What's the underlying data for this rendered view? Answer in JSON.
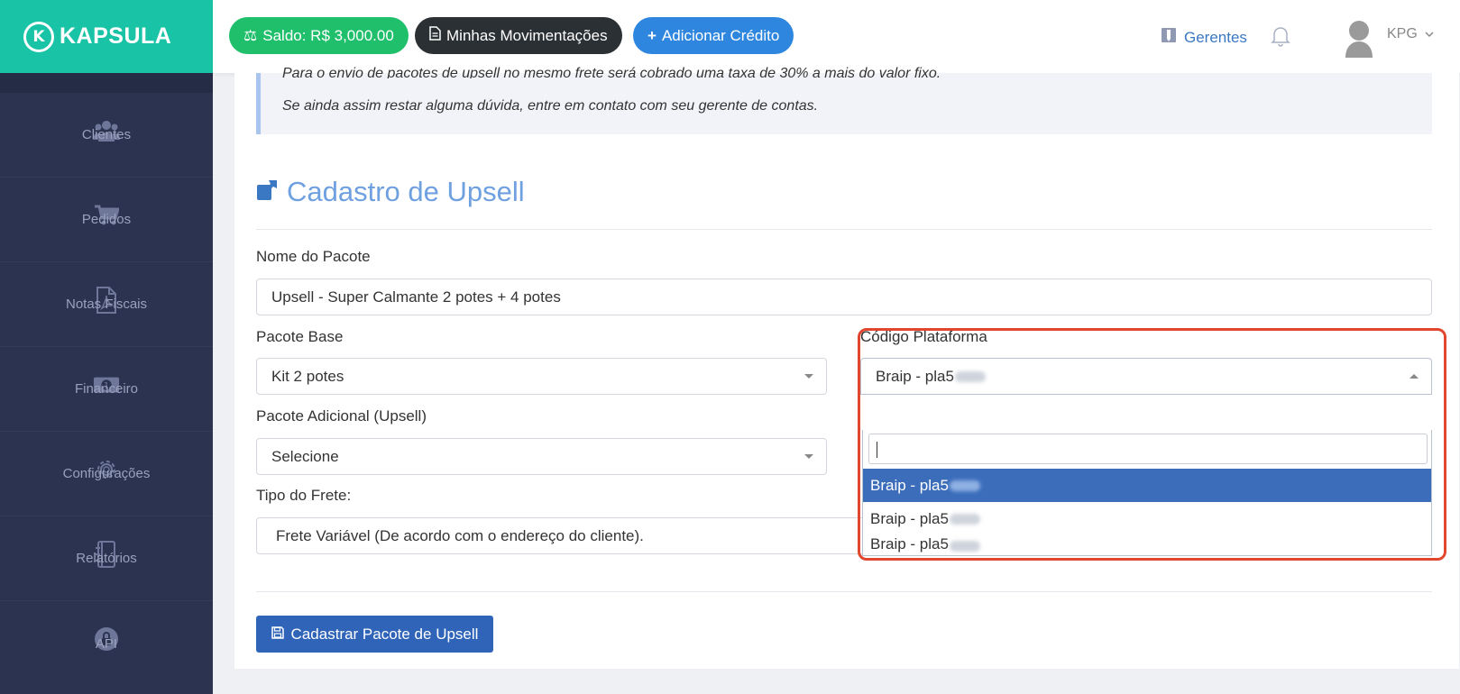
{
  "brand": {
    "name": "KAPSULA"
  },
  "sidebar": {
    "items": [
      {
        "label": "Clientes",
        "icon": "users-icon"
      },
      {
        "label": "Pedidos",
        "icon": "cart-icon"
      },
      {
        "label": "Notas Fiscais",
        "icon": "pdf-file-icon"
      },
      {
        "label": "Financeiro",
        "icon": "money-icon"
      },
      {
        "label": "Configurações",
        "icon": "gear-icon"
      },
      {
        "label": "Relatórios",
        "icon": "notebook-icon"
      },
      {
        "label": "API",
        "icon": "lock-icon"
      }
    ]
  },
  "topbar": {
    "saldo": "Saldo: R$ 3,000.00",
    "movimentacoes": "Minhas Movimentações",
    "adicionar": "Adicionar Crédito",
    "gerentes": "Gerentes",
    "user": "KPG"
  },
  "notice": {
    "cut_line": "Para o envio de pacotes de upsell no mesmo frete será cobrado uma taxa de 30% a mais do valor fixo.",
    "text": "Se ainda assim restar alguma dúvida, entre em contato com seu gerente de contas."
  },
  "form": {
    "title": "Cadastro de Upsell",
    "nome_label": "Nome do Pacote",
    "nome_value": "Upsell - Super Calmante 2 potes + 4 potes",
    "base_label": "Pacote Base",
    "base_value": "Kit 2 potes",
    "adicional_label": "Pacote Adicional (Upsell)",
    "adicional_value": "Selecione",
    "frete_label": "Tipo do Frete:",
    "frete_value": "Frete Variável (De acordo com o endereço do cliente).",
    "codigo_label": "Código Plataforma",
    "codigo_value": "Braip - pla5",
    "submit": "Cadastrar Pacote de Upsell"
  },
  "dropdown": {
    "search_value": "",
    "options": [
      "Braip - pla5",
      "Braip - pla5",
      "Braip - pla5"
    ],
    "selected_index": 0
  },
  "colors": {
    "brand": "#19c3a6",
    "sidebar": "#2b3350",
    "saldo": "#1fbf6b",
    "add": "#2e86de",
    "primary": "#2f64b8",
    "highlight": "#e1472f"
  }
}
